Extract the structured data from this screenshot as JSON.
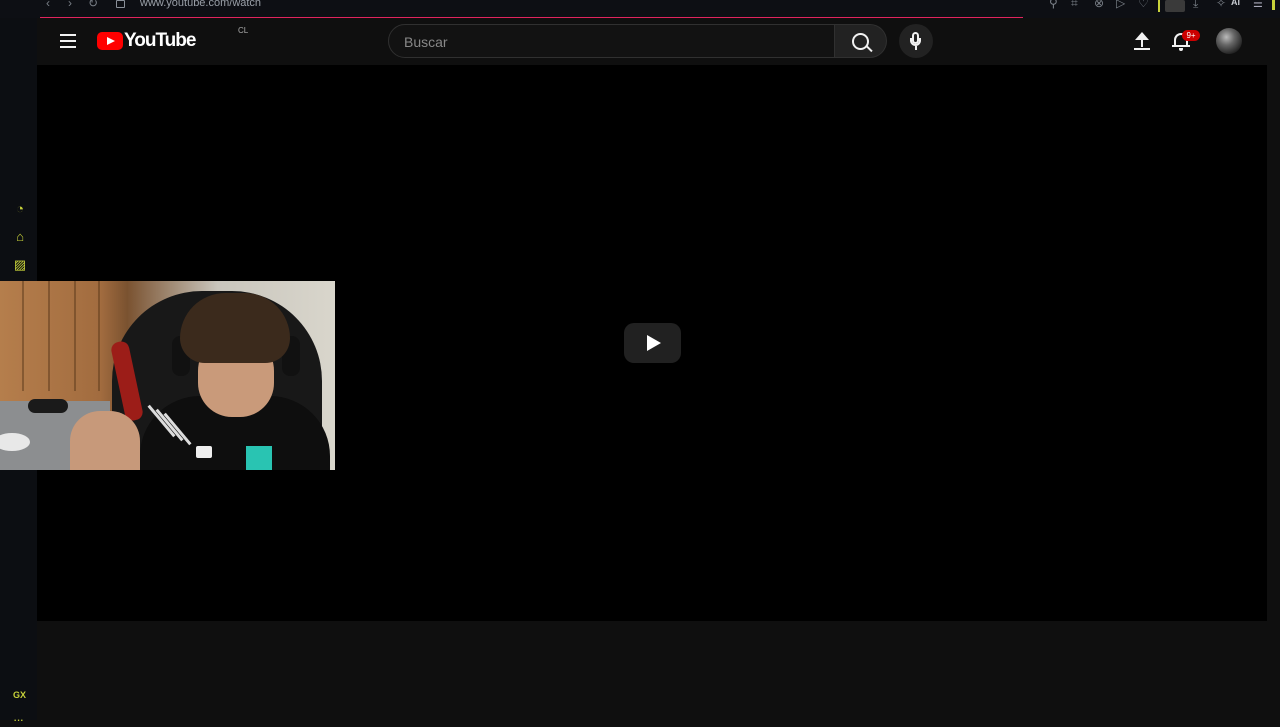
{
  "browser": {
    "url": "www.youtube.com/watch",
    "ai_label": "AI"
  },
  "gx_sidebar": {
    "label": "GX",
    "more": "···",
    "icons": [
      "speedometer-icon",
      "broom-icon",
      "pattern-icon"
    ]
  },
  "header": {
    "logo_text": "YouTube",
    "country_code": "CL",
    "search_placeholder": "Buscar",
    "notification_count": "9+"
  },
  "player": {
    "state": "paused"
  },
  "colors": {
    "accent_gx": "#c8d23a",
    "loading_bar": "#e0245e",
    "youtube_red": "#ff0000",
    "badge": "#cc0000"
  }
}
